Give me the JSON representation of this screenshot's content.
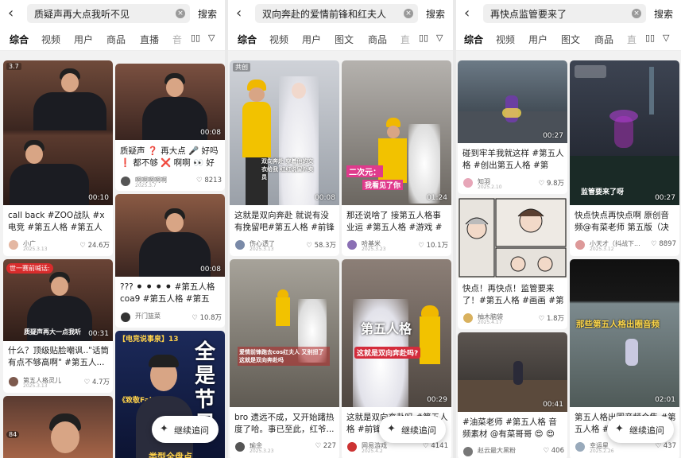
{
  "panels": [
    {
      "query": "质疑声再大点我听不见",
      "search_label": "搜索",
      "tabs": [
        "综合",
        "视频",
        "用户",
        "商品",
        "直播",
        "音"
      ],
      "follow_label": "继续追问",
      "cards": [
        {
          "badge": "3.7",
          "duration": "00:10",
          "title": "call back #ZOO战队 #x电竞 #第五人格 #第五人格...",
          "author": "小广",
          "date": "2025.3.13",
          "likes": "24.6万"
        },
        {
          "duration": "00:08",
          "title": "质疑声 ❓ 再大点 🎤 好吗 ❗ 都不够 ❌ 啊啊 👀 好吗 #深...",
          "author": "啊啊啊啊啊",
          "date": "2025.3.7",
          "likes": "8213"
        },
        {
          "red_badge": "世一赛前喊话:",
          "overlay": "质疑声再大一点我听",
          "duration": "00:31",
          "title": "什么？顶级贴脸嘲讽..\"话筒有点不够高啊\" #第五人...",
          "author": "第五人格灵儿",
          "date": "2025.3.13",
          "likes": "4.7万"
        },
        {
          "duration": "00:08",
          "title": "??? ⚫ ⚫ ⚫ ⚫ #第五人格coa9 #第五人格 #第五人...",
          "author": "开门篮菜",
          "date": "2025.3.9",
          "likes": "10.8万"
        },
        {
          "badge": "84",
          "title": "",
          "author": "",
          "date": "",
          "likes": ""
        },
        {
          "overlay": "全是节目",
          "subtitle": "《致敬Faker》",
          "subtitle2": "【电竞说事泉】13",
          "caption": "类型全盘点",
          "title": "",
          "author": "",
          "date": "",
          "likes": ""
        }
      ]
    },
    {
      "query": "双向奔赴的爱情前锋和红夫人",
      "search_label": "搜索",
      "tabs": [
        "综合",
        "视频",
        "用户",
        "图文",
        "商品",
        "直"
      ],
      "follow_label": "继续追问",
      "cards": [
        {
          "badge": "共创",
          "duration": "00:08",
          "overlay": "双向奔赴 穿着他的文衣给我 红红说留外卖员",
          "title": "这就是双向奔赴 就说有没有挽留吧#第五人格 #前锋 #...",
          "author": "伤心透了",
          "date": "2025.3.13",
          "likes": "58.3万"
        },
        {
          "overlay": "二次元：",
          "overlay2": "我看见了你",
          "duration": "01:24",
          "title": "那还说啥了 接第五人格事业运 #第五人格 #游戏 #红夫...",
          "author": "哈基米",
          "date": "2025.3.23",
          "likes": "10.1万"
        },
        {
          "overlay": "爱情前锋跑去cos红夫人 又别扭了 这就是双向奔赴吗",
          "title": "bro 遗远不成，又开始躇热度了哈。事已至此，红爷...",
          "author": "瑜余",
          "date": "2025.3.23",
          "likes": "227"
        },
        {
          "overlay": "第五人格",
          "overlay2": "这就是双向奔赴吗?",
          "duration": "00:29",
          "title": "这就是双向奔赴吗 #第五人格 #前锋...",
          "author": "网易游戏",
          "date": "2025.4.2",
          "likes": "4141"
        }
      ]
    },
    {
      "query": "再快点监管要来了",
      "search_label": "搜索",
      "tabs": [
        "综合",
        "视频",
        "用户",
        "图文",
        "商品",
        "直"
      ],
      "follow_label": "继续追问",
      "cards": [
        {
          "duration": "00:27",
          "title": "碰到牢羊我就这样 #第五人格 #创出第五人格 #第五...",
          "author": "知羽",
          "date": "2025.2.10",
          "likes": "9.8万"
        },
        {
          "overlay": "监管要来了呀",
          "duration": "00:27",
          "title": "快点快点再快点啊 原创音频@有菜老师 第五版（决心...",
          "author": "小天才（抖战下...",
          "date": "2025.3.12",
          "likes": "8897"
        },
        {
          "title": "快点！再快点！监管要来了！#第五人格 #画画 #第五...",
          "author": "柚木脑袋",
          "date": "2025.4.17",
          "likes": "1.8万"
        },
        {
          "overlay": "那些第五人格出圈音频",
          "duration": "02:01",
          "title": "第五人格出圈音频合集 #第五人格 #第五人...",
          "author": "幸运星",
          "date": "2025.2.26",
          "likes": "437"
        },
        {
          "duration": "00:41",
          "title": "#油菜老师 #第五人格 音频素材 @有菜哥哥 😍 😍",
          "author": "赵云最大黑粉",
          "date": "2025.3.31",
          "likes": "406"
        }
      ]
    }
  ],
  "colors": {
    "accent": "#fe2c55",
    "page_bg": "#f2f2f2"
  }
}
